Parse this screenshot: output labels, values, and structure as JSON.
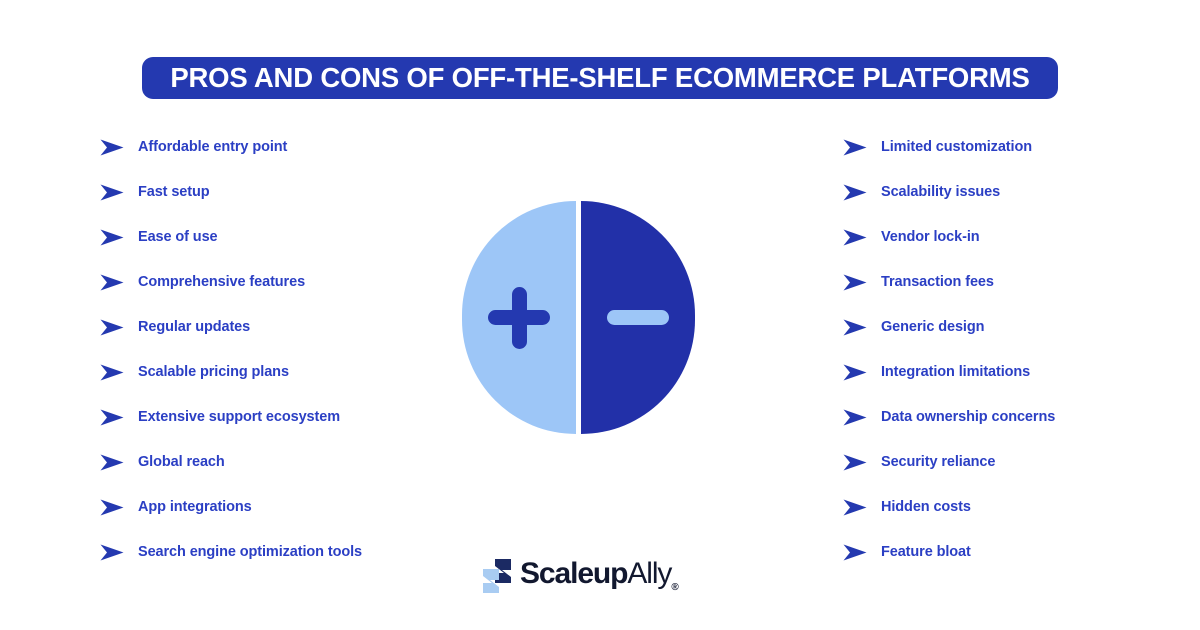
{
  "header": {
    "title": "PROS AND CONS OF OFF-THE-SHELF ECOMMERCE PLATFORMS",
    "banner_color": "#2439B0",
    "title_color": "#FFFFFF"
  },
  "theme": {
    "accent_blue": "#2B3FC4",
    "deep_blue": "#2230A8",
    "light_blue": "#9DC6F7",
    "background": "#FFFFFF",
    "logo_text_color": "#12182F"
  },
  "pros": {
    "side": "left",
    "symbol": "plus",
    "items": [
      {
        "label": "Affordable entry point",
        "icon": "arrow-right-icon"
      },
      {
        "label": "Fast setup",
        "icon": "arrow-right-icon"
      },
      {
        "label": "Ease of use",
        "icon": "arrow-right-icon"
      },
      {
        "label": "Comprehensive features",
        "icon": "arrow-right-icon"
      },
      {
        "label": "Regular updates",
        "icon": "arrow-right-icon"
      },
      {
        "label": "Scalable pricing plans",
        "icon": "arrow-right-icon"
      },
      {
        "label": "Extensive support ecosystem",
        "icon": "arrow-right-icon"
      },
      {
        "label": "Global reach",
        "icon": "arrow-right-icon"
      },
      {
        "label": "App integrations",
        "icon": "arrow-right-icon"
      },
      {
        "label": "Search engine optimization tools",
        "icon": "arrow-right-icon"
      }
    ]
  },
  "cons": {
    "side": "right",
    "symbol": "minus",
    "items": [
      {
        "label": "Limited customization",
        "icon": "arrow-right-icon"
      },
      {
        "label": "Scalability issues",
        "icon": "arrow-right-icon"
      },
      {
        "label": "Vendor lock-in",
        "icon": "arrow-right-icon"
      },
      {
        "label": "Transaction fees",
        "icon": "arrow-right-icon"
      },
      {
        "label": "Generic design",
        "icon": "arrow-right-icon"
      },
      {
        "label": "Integration limitations",
        "icon": "arrow-right-icon"
      },
      {
        "label": "Data ownership concerns",
        "icon": "arrow-right-icon"
      },
      {
        "label": "Security reliance",
        "icon": "arrow-right-icon"
      },
      {
        "label": "Hidden costs",
        "icon": "arrow-right-icon"
      },
      {
        "label": "Feature bloat",
        "icon": "arrow-right-icon"
      }
    ]
  },
  "center_graphic": {
    "plus_sign": "+",
    "minus_sign": "−",
    "plus_half_color": "#9DC6F7",
    "minus_half_color": "#2230A8"
  },
  "logo": {
    "name_bold": "Scaleup",
    "name_light": "Ally",
    "registered_mark": "®"
  }
}
